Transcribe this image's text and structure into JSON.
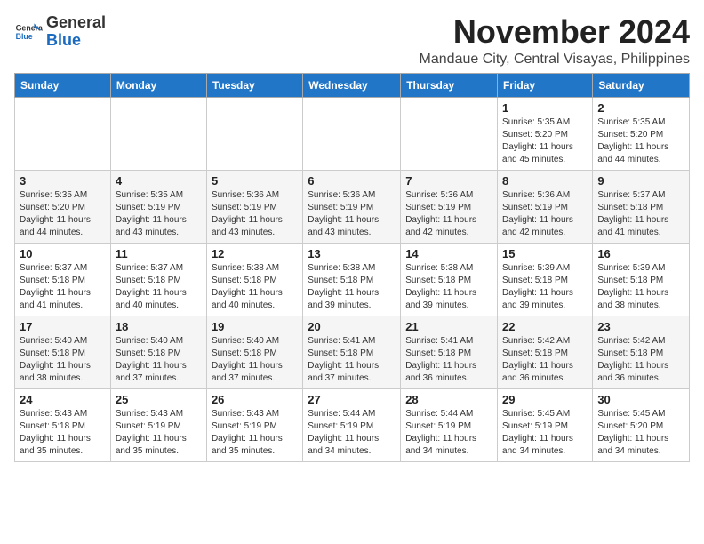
{
  "logo": {
    "general": "General",
    "blue": "Blue"
  },
  "header": {
    "month": "November 2024",
    "location": "Mandauе City, Central Visayas, Philippines"
  },
  "weekdays": [
    "Sunday",
    "Monday",
    "Tuesday",
    "Wednesday",
    "Thursday",
    "Friday",
    "Saturday"
  ],
  "weeks": [
    [
      {
        "day": "",
        "info": ""
      },
      {
        "day": "",
        "info": ""
      },
      {
        "day": "",
        "info": ""
      },
      {
        "day": "",
        "info": ""
      },
      {
        "day": "",
        "info": ""
      },
      {
        "day": "1",
        "info": "Sunrise: 5:35 AM\nSunset: 5:20 PM\nDaylight: 11 hours and 45 minutes."
      },
      {
        "day": "2",
        "info": "Sunrise: 5:35 AM\nSunset: 5:20 PM\nDaylight: 11 hours and 44 minutes."
      }
    ],
    [
      {
        "day": "3",
        "info": "Sunrise: 5:35 AM\nSunset: 5:20 PM\nDaylight: 11 hours and 44 minutes."
      },
      {
        "day": "4",
        "info": "Sunrise: 5:35 AM\nSunset: 5:19 PM\nDaylight: 11 hours and 43 minutes."
      },
      {
        "day": "5",
        "info": "Sunrise: 5:36 AM\nSunset: 5:19 PM\nDaylight: 11 hours and 43 minutes."
      },
      {
        "day": "6",
        "info": "Sunrise: 5:36 AM\nSunset: 5:19 PM\nDaylight: 11 hours and 43 minutes."
      },
      {
        "day": "7",
        "info": "Sunrise: 5:36 AM\nSunset: 5:19 PM\nDaylight: 11 hours and 42 minutes."
      },
      {
        "day": "8",
        "info": "Sunrise: 5:36 AM\nSunset: 5:19 PM\nDaylight: 11 hours and 42 minutes."
      },
      {
        "day": "9",
        "info": "Sunrise: 5:37 AM\nSunset: 5:18 PM\nDaylight: 11 hours and 41 minutes."
      }
    ],
    [
      {
        "day": "10",
        "info": "Sunrise: 5:37 AM\nSunset: 5:18 PM\nDaylight: 11 hours and 41 minutes."
      },
      {
        "day": "11",
        "info": "Sunrise: 5:37 AM\nSunset: 5:18 PM\nDaylight: 11 hours and 40 minutes."
      },
      {
        "day": "12",
        "info": "Sunrise: 5:38 AM\nSunset: 5:18 PM\nDaylight: 11 hours and 40 minutes."
      },
      {
        "day": "13",
        "info": "Sunrise: 5:38 AM\nSunset: 5:18 PM\nDaylight: 11 hours and 39 minutes."
      },
      {
        "day": "14",
        "info": "Sunrise: 5:38 AM\nSunset: 5:18 PM\nDaylight: 11 hours and 39 minutes."
      },
      {
        "day": "15",
        "info": "Sunrise: 5:39 AM\nSunset: 5:18 PM\nDaylight: 11 hours and 39 minutes."
      },
      {
        "day": "16",
        "info": "Sunrise: 5:39 AM\nSunset: 5:18 PM\nDaylight: 11 hours and 38 minutes."
      }
    ],
    [
      {
        "day": "17",
        "info": "Sunrise: 5:40 AM\nSunset: 5:18 PM\nDaylight: 11 hours and 38 minutes."
      },
      {
        "day": "18",
        "info": "Sunrise: 5:40 AM\nSunset: 5:18 PM\nDaylight: 11 hours and 37 minutes."
      },
      {
        "day": "19",
        "info": "Sunrise: 5:40 AM\nSunset: 5:18 PM\nDaylight: 11 hours and 37 minutes."
      },
      {
        "day": "20",
        "info": "Sunrise: 5:41 AM\nSunset: 5:18 PM\nDaylight: 11 hours and 37 minutes."
      },
      {
        "day": "21",
        "info": "Sunrise: 5:41 AM\nSunset: 5:18 PM\nDaylight: 11 hours and 36 minutes."
      },
      {
        "day": "22",
        "info": "Sunrise: 5:42 AM\nSunset: 5:18 PM\nDaylight: 11 hours and 36 minutes."
      },
      {
        "day": "23",
        "info": "Sunrise: 5:42 AM\nSunset: 5:18 PM\nDaylight: 11 hours and 36 minutes."
      }
    ],
    [
      {
        "day": "24",
        "info": "Sunrise: 5:43 AM\nSunset: 5:18 PM\nDaylight: 11 hours and 35 minutes."
      },
      {
        "day": "25",
        "info": "Sunrise: 5:43 AM\nSunset: 5:19 PM\nDaylight: 11 hours and 35 minutes."
      },
      {
        "day": "26",
        "info": "Sunrise: 5:43 AM\nSunset: 5:19 PM\nDaylight: 11 hours and 35 minutes."
      },
      {
        "day": "27",
        "info": "Sunrise: 5:44 AM\nSunset: 5:19 PM\nDaylight: 11 hours and 34 minutes."
      },
      {
        "day": "28",
        "info": "Sunrise: 5:44 AM\nSunset: 5:19 PM\nDaylight: 11 hours and 34 minutes."
      },
      {
        "day": "29",
        "info": "Sunrise: 5:45 AM\nSunset: 5:19 PM\nDaylight: 11 hours and 34 minutes."
      },
      {
        "day": "30",
        "info": "Sunrise: 5:45 AM\nSunset: 5:20 PM\nDaylight: 11 hours and 34 minutes."
      }
    ]
  ]
}
